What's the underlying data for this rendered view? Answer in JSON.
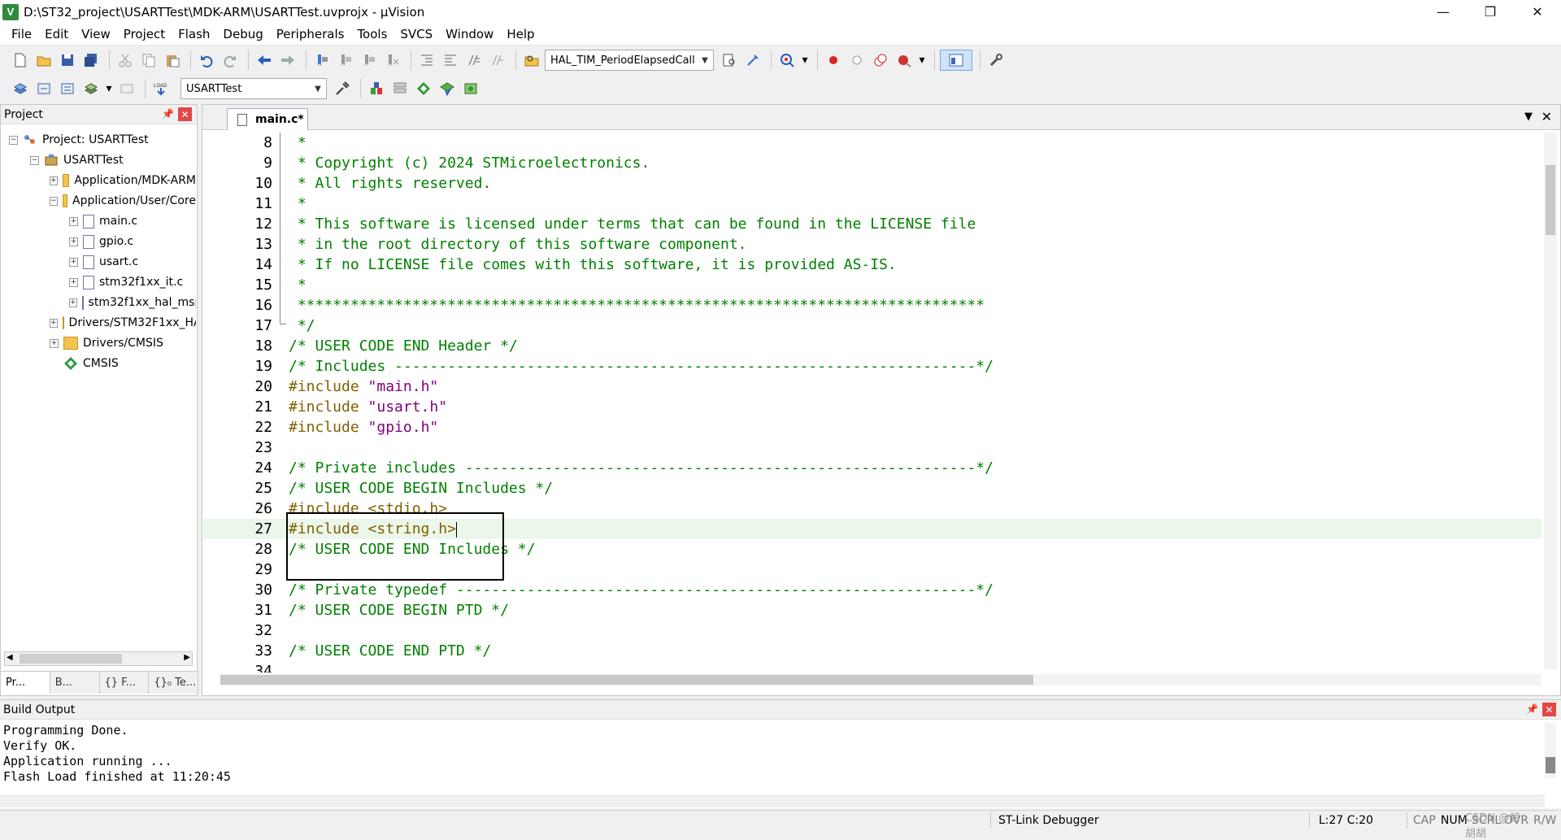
{
  "window": {
    "title": "D:\\ST32_project\\USARTTest\\MDK-ARM\\USARTTest.uvprojx - µVision",
    "app_icon": "V"
  },
  "menu": [
    "File",
    "Edit",
    "View",
    "Project",
    "Flash",
    "Debug",
    "Peripherals",
    "Tools",
    "SVCS",
    "Window",
    "Help"
  ],
  "toolbar": {
    "find_combo": "HAL_TIM_PeriodElapsedCall",
    "target_combo": "USARTTest",
    "load_label": "LOAD"
  },
  "project_panel": {
    "title": "Project",
    "tree": [
      {
        "label": "Project: USARTTest",
        "level": 0,
        "expander": "−",
        "icon": "project"
      },
      {
        "label": "USARTTest",
        "level": 1,
        "expander": "−",
        "icon": "target"
      },
      {
        "label": "Application/MDK-ARM",
        "level": 2,
        "expander": "+",
        "icon": "folder"
      },
      {
        "label": "Application/User/Core",
        "level": 2,
        "expander": "−",
        "icon": "folder"
      },
      {
        "label": "main.c",
        "level": 3,
        "expander": "+",
        "icon": "file"
      },
      {
        "label": "gpio.c",
        "level": 3,
        "expander": "+",
        "icon": "file"
      },
      {
        "label": "usart.c",
        "level": 3,
        "expander": "+",
        "icon": "file"
      },
      {
        "label": "stm32f1xx_it.c",
        "level": 3,
        "expander": "+",
        "icon": "file"
      },
      {
        "label": "stm32f1xx_hal_msp.c",
        "level": 3,
        "expander": "+",
        "icon": "file"
      },
      {
        "label": "Drivers/STM32F1xx_HAL_Driver",
        "level": 2,
        "expander": "+",
        "icon": "folder"
      },
      {
        "label": "Drivers/CMSIS",
        "level": 2,
        "expander": "+",
        "icon": "folder"
      },
      {
        "label": "CMSIS",
        "level": 2,
        "expander": "",
        "icon": "cmsis"
      }
    ],
    "tabs": [
      "Pr...",
      "B...",
      "{} F...",
      "{}₀ Te..."
    ]
  },
  "editor": {
    "tab_label": "main.c*",
    "current_line": 27,
    "lines": [
      {
        "n": "8",
        "t": " *",
        "k": "c"
      },
      {
        "n": "9",
        "t": " * Copyright (c) 2024 STMicroelectronics.",
        "k": "c"
      },
      {
        "n": "10",
        "t": " * All rights reserved.",
        "k": "c"
      },
      {
        "n": "11",
        "t": " *",
        "k": "c"
      },
      {
        "n": "12",
        "t": " * This software is licensed under terms that can be found in the LICENSE file",
        "k": "c"
      },
      {
        "n": "13",
        "t": " * in the root directory of this software component.",
        "k": "c"
      },
      {
        "n": "14",
        "t": " * If no LICENSE file comes with this software, it is provided AS-IS.",
        "k": "c"
      },
      {
        "n": "15",
        "t": " *",
        "k": "c"
      },
      {
        "n": "16",
        "t": " ******************************************************************************",
        "k": "c"
      },
      {
        "n": "17",
        "t": " */",
        "k": "c"
      },
      {
        "n": "18",
        "t": "/* USER CODE END Header */",
        "k": "c"
      },
      {
        "n": "19",
        "t": "/* Includes ------------------------------------------------------------------*/",
        "k": "c"
      },
      {
        "n": "20",
        "t": "#include ",
        "k": "pp",
        "s": "\"main.h\""
      },
      {
        "n": "21",
        "t": "#include ",
        "k": "pp",
        "s": "\"usart.h\""
      },
      {
        "n": "22",
        "t": "#include ",
        "k": "pp",
        "s": "\"gpio.h\""
      },
      {
        "n": "23",
        "t": "",
        "k": "c"
      },
      {
        "n": "24",
        "t": "/* Private includes ----------------------------------------------------------*/",
        "k": "c"
      },
      {
        "n": "25",
        "t": "/* USER CODE BEGIN Includes */",
        "k": "c"
      },
      {
        "n": "26",
        "t": "#include <stdio.h>",
        "k": "pp"
      },
      {
        "n": "27",
        "t": "#include <string.h>",
        "k": "pp"
      },
      {
        "n": "28",
        "t": "/* USER CODE END Includes */",
        "k": "c"
      },
      {
        "n": "29",
        "t": "",
        "k": "c"
      },
      {
        "n": "30",
        "t": "/* Private typedef -----------------------------------------------------------*/",
        "k": "c"
      },
      {
        "n": "31",
        "t": "/* USER CODE BEGIN PTD */",
        "k": "c"
      },
      {
        "n": "32",
        "t": "",
        "k": "c"
      },
      {
        "n": "33",
        "t": "/* USER CODE END PTD */",
        "k": "c"
      },
      {
        "n": "34",
        "t": "",
        "k": "c"
      }
    ]
  },
  "build_output": {
    "title": "Build Output",
    "text": "Programming Done.\nVerify OK.\nApplication running ...\nFlash Load finished at 11:20:45"
  },
  "status": {
    "debugger": "ST-Link Debugger",
    "position": "L:27 C:20",
    "cap": "CAP",
    "num": "NUM",
    "scrl": "SCRL",
    "ovr": "OVR",
    "rw": "R/W",
    "watermark": "CSDN @胡胡胡"
  },
  "colors": {
    "comment": "#008000",
    "preprocessor": "#806000",
    "string": "#800080",
    "current_line_bg": "#eaf7ea"
  }
}
